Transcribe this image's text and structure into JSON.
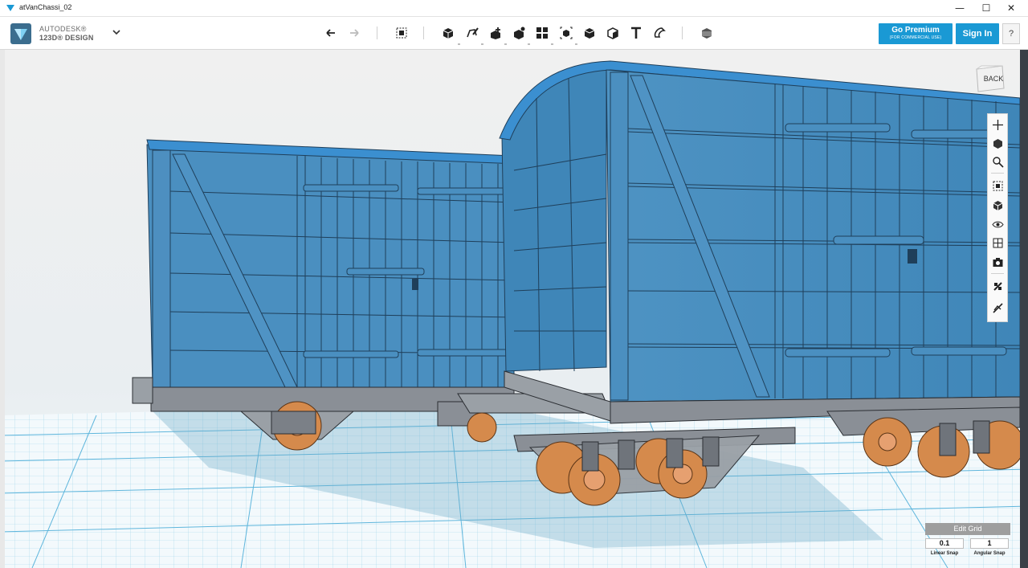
{
  "window": {
    "title": "atVanChassi_02",
    "controls": {
      "minimize": "—",
      "maximize": "☐",
      "close": "✕"
    }
  },
  "brand": {
    "line1": "AUTODESK®",
    "line2": "123D® DESIGN",
    "logo_icon": "autodesk-123d-logo-icon",
    "menu_icon": "chevron-down-icon"
  },
  "toolbar": {
    "tools": [
      {
        "name": "undo-icon"
      },
      {
        "name": "redo-icon"
      },
      {
        "name": "transform-icon"
      },
      {
        "name": "primitives-icon"
      },
      {
        "name": "sketch-icon"
      },
      {
        "name": "construct-icon"
      },
      {
        "name": "modify-icon"
      },
      {
        "name": "pattern-icon"
      },
      {
        "name": "grouping-icon"
      },
      {
        "name": "combine-icon"
      },
      {
        "name": "measure-icon"
      },
      {
        "name": "text-icon"
      },
      {
        "name": "snap-icon"
      },
      {
        "name": "material-icon"
      }
    ]
  },
  "account": {
    "premium_label": "Go Premium",
    "premium_sub": "(FOR COMMERCIAL USE)",
    "signin_label": "Sign In",
    "help_label": "?"
  },
  "viewcube": {
    "face_label": "BACK"
  },
  "navbar": {
    "tools": [
      {
        "name": "pan-icon"
      },
      {
        "name": "orbit-icon"
      },
      {
        "name": "zoom-icon"
      },
      {
        "name": "fit-icon"
      },
      {
        "name": "view-cube-icon"
      },
      {
        "name": "visibility-icon"
      },
      {
        "name": "materials-outlines-icon"
      },
      {
        "name": "snapshot-icon"
      },
      {
        "name": "grid-snap-icon"
      },
      {
        "name": "hide-icon"
      }
    ]
  },
  "grid": {
    "title": "Edit Grid",
    "linear_snap_value": "0.1",
    "angular_snap_value": "1",
    "linear_snap_label": "Linear Snap",
    "angular_snap_label": "Angular Snap"
  },
  "colors": {
    "accent": "#1a99d4",
    "model_body": "#4a8fc0",
    "model_dark": "#2d6d9c",
    "wheel": "#d58a4c",
    "chassis": "#8a8f96",
    "grid_bg": "#eef5f9",
    "grid_line": "#7fc6e6"
  }
}
